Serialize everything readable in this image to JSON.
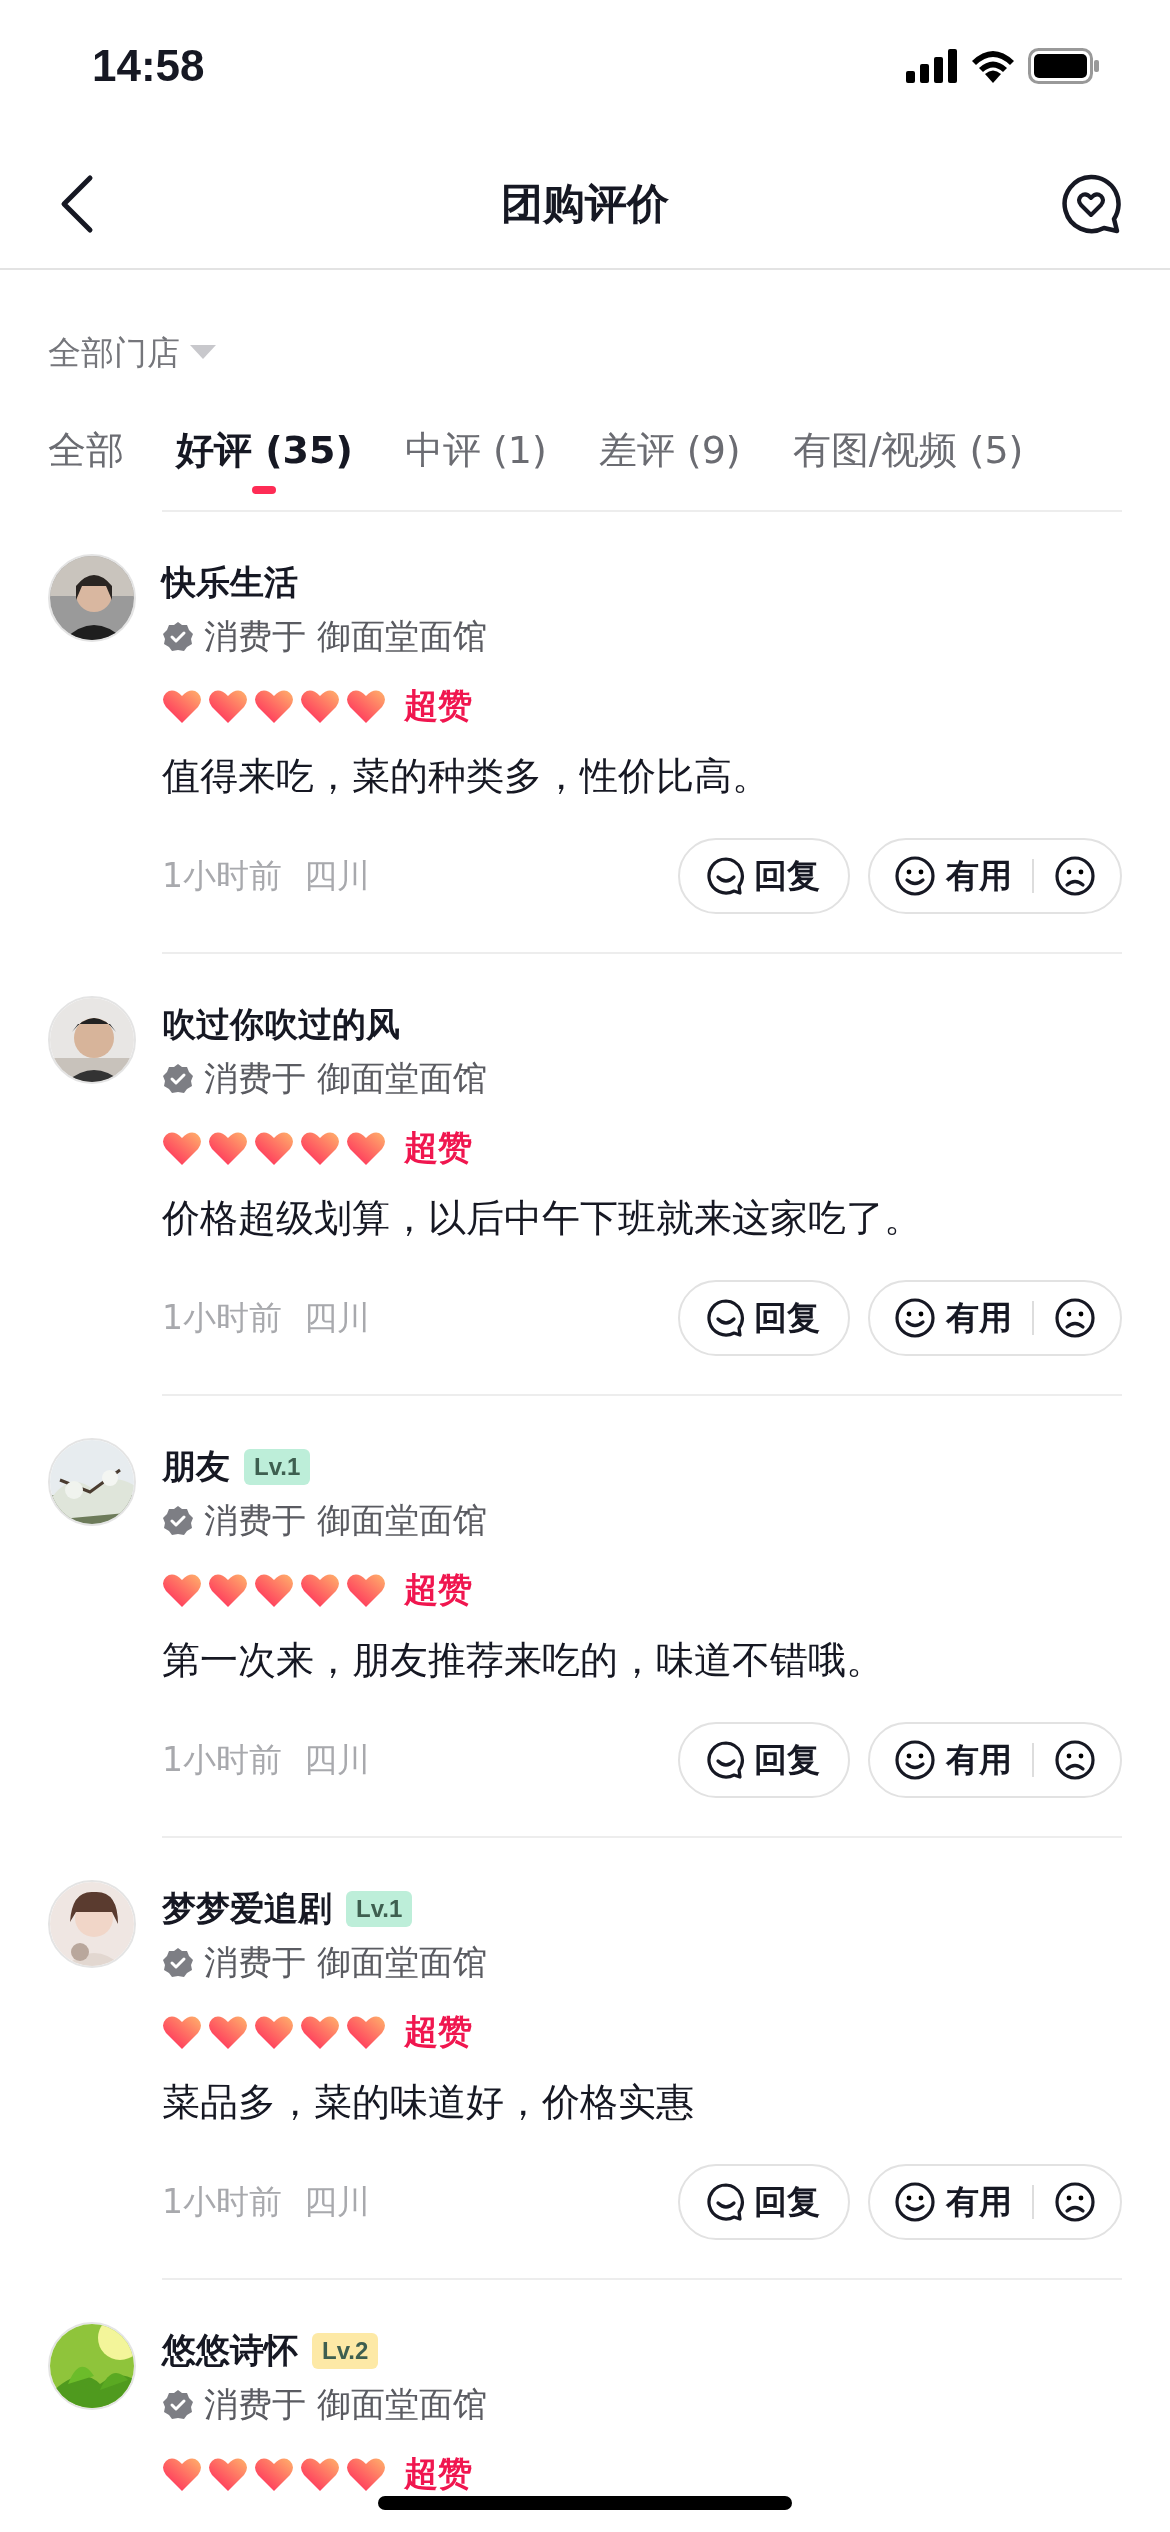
{
  "status_bar": {
    "time": "14:58"
  },
  "nav": {
    "title": "团购评价"
  },
  "store_filter": {
    "label": "全部门店"
  },
  "tabs": [
    {
      "label": "全部",
      "selected": false
    },
    {
      "label": "好评 (35)",
      "selected": true
    },
    {
      "label": "中评 (1)",
      "selected": false
    },
    {
      "label": "差评 (9)",
      "selected": false
    },
    {
      "label": "有图/视频 (5)",
      "selected": false
    }
  ],
  "reviews": [
    {
      "user": "快乐生活",
      "consumed_at": "消费于 御面堂面馆",
      "stars": 5,
      "rating_label": "超赞",
      "text": "值得来吃，菜的种类多，性价比高。",
      "time": "1小时前",
      "location": "四川",
      "reply": "回复",
      "useful": "有用"
    },
    {
      "user": "吹过你吹过的风",
      "consumed_at": "消费于 御面堂面馆",
      "stars": 5,
      "rating_label": "超赞",
      "text": "价格超级划算，以后中午下班就来这家吃了。",
      "time": "1小时前",
      "location": "四川",
      "reply": "回复",
      "useful": "有用"
    },
    {
      "user": "朋友",
      "badge": {
        "text": "Lv.1",
        "color": "#bdeed9"
      },
      "consumed_at": "消费于 御面堂面馆",
      "stars": 5,
      "rating_label": "超赞",
      "text": "第一次来，朋友推荐来吃的，味道不错哦。",
      "time": "1小时前",
      "location": "四川",
      "reply": "回复",
      "useful": "有用"
    },
    {
      "user": "梦梦爱追剧",
      "badge": {
        "text": "Lv.1",
        "color": "#bdeed9"
      },
      "consumed_at": "消费于 御面堂面馆",
      "stars": 5,
      "rating_label": "超赞",
      "text": "菜品多，菜的味道好，价格实惠",
      "time": "1小时前",
      "location": "四川",
      "reply": "回复",
      "useful": "有用"
    },
    {
      "user": "悠悠诗怀",
      "badge": {
        "text": "Lv.2",
        "color": "#fde9a6"
      },
      "consumed_at": "消费于 御面堂面馆",
      "stars": 5,
      "rating_label": "超赞"
    }
  ]
}
